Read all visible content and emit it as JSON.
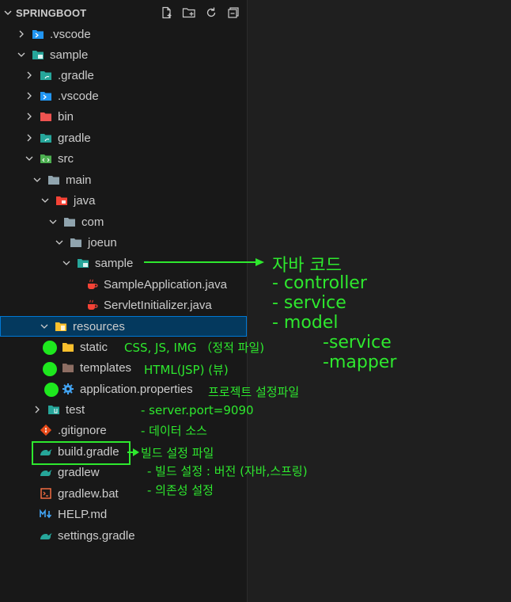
{
  "explorer": {
    "title": "SPRINGBOOT",
    "actions": [
      {
        "name": "new-file-icon"
      },
      {
        "name": "new-folder-icon"
      },
      {
        "name": "refresh-icon"
      },
      {
        "name": "collapse-all-icon"
      }
    ]
  },
  "tree": [
    {
      "label": ".vscode",
      "icon": "folder-vscode-icon",
      "twisty": "right"
    },
    {
      "label": "sample",
      "icon": "folder-sample-icon",
      "twisty": "down"
    },
    {
      "label": ".gradle",
      "icon": "folder-gradle-icon",
      "twisty": "right"
    },
    {
      "label": ".vscode",
      "icon": "folder-vscode-icon",
      "twisty": "right"
    },
    {
      "label": "bin",
      "icon": "folder-bin-icon",
      "twisty": "right"
    },
    {
      "label": "gradle",
      "icon": "folder-gradle-icon",
      "twisty": "right"
    },
    {
      "label": "src",
      "icon": "folder-src-icon",
      "twisty": "down"
    },
    {
      "label": "main",
      "icon": "folder-icon",
      "twisty": "down"
    },
    {
      "label": "java",
      "icon": "folder-java-icon",
      "twisty": "down"
    },
    {
      "label": "com",
      "icon": "folder-icon",
      "twisty": "down"
    },
    {
      "label": "joeun",
      "icon": "folder-icon",
      "twisty": "down"
    },
    {
      "label": "sample",
      "icon": "folder-sample-icon",
      "twisty": "down"
    },
    {
      "label": "SampleApplication.java",
      "icon": "java-file-icon",
      "twisty": ""
    },
    {
      "label": "ServletInitializer.java",
      "icon": "java-file-icon",
      "twisty": ""
    },
    {
      "label": "resources",
      "icon": "folder-resources-icon",
      "twisty": "down"
    },
    {
      "label": "static",
      "icon": "folder-static-icon",
      "twisty": ""
    },
    {
      "label": "templates",
      "icon": "folder-templates-icon",
      "twisty": ""
    },
    {
      "label": "application.properties",
      "icon": "gear-icon",
      "twisty": ""
    },
    {
      "label": "test",
      "icon": "folder-test-icon",
      "twisty": "right"
    },
    {
      "label": ".gitignore",
      "icon": "git-icon",
      "twisty": ""
    },
    {
      "label": "build.gradle",
      "icon": "gradle-file-icon",
      "twisty": ""
    },
    {
      "label": "gradlew",
      "icon": "gradle-file-icon",
      "twisty": ""
    },
    {
      "label": "gradlew.bat",
      "icon": "terminal-file-icon",
      "twisty": ""
    },
    {
      "label": "HELP.md",
      "icon": "markdown-icon",
      "twisty": ""
    },
    {
      "label": "settings.gradle",
      "icon": "gradle-file-icon",
      "twisty": ""
    }
  ],
  "annotations": {
    "java_code": "자바 코드",
    "controller": "- controller",
    "service": "- service",
    "model": "- model",
    "model_service": "-service",
    "model_mapper": "-mapper",
    "static_note": "CSS, JS, IMG （정적 파일)",
    "templates_note": "HTML(JSP) (뷰)",
    "properties_note": "프로젝트 설정파일",
    "port_note": "-  server.port=9090",
    "datasource_note": "-  데이터 소스",
    "build_note": "빌드 설정 파일",
    "build_version_note": "- 빌드 설정 : 버전 (자바,스프링)",
    "dependency_note": "- 의존성 설정"
  },
  "colors": {
    "annotation": "#2ee82e",
    "selection_bg": "#04395e",
    "selection_border": "#0078d4",
    "sidebar_bg": "#181818"
  }
}
